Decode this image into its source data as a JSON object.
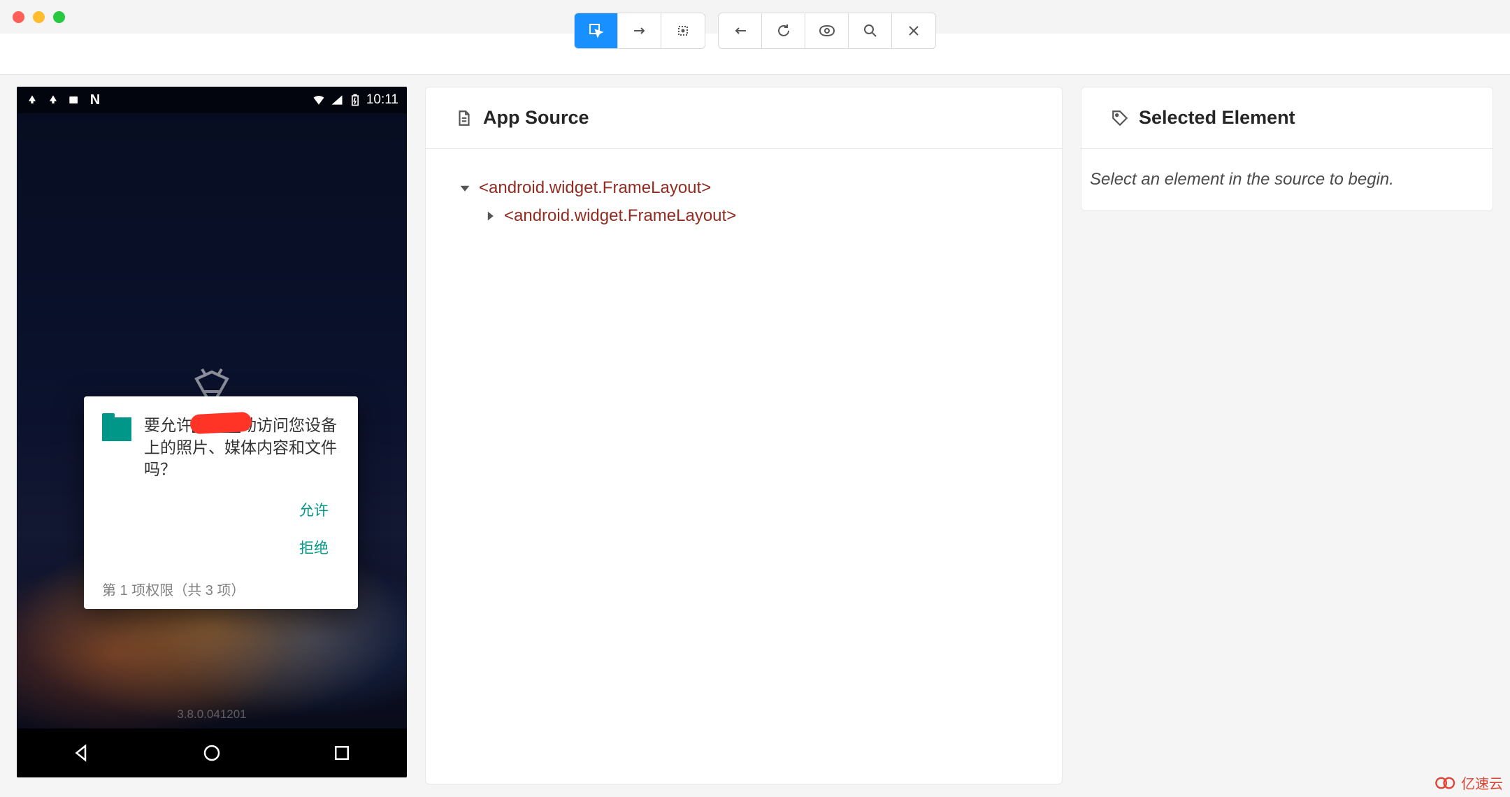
{
  "device": {
    "status_time": "10:11",
    "dialog": {
      "text": "要允许▇▇▇动访问您设备上的照片、媒体内容和文件吗？",
      "allow": "允许",
      "deny": "拒绝",
      "footer": "第 1 项权限（共 3 项）"
    },
    "version": "3.8.0.041201"
  },
  "source": {
    "title": "App Source",
    "root": "<android.widget.FrameLayout>",
    "child": "<android.widget.FrameLayout>"
  },
  "selected": {
    "title": "Selected Element",
    "placeholder": "Select an element in the source to begin."
  },
  "watermark": "亿速云"
}
